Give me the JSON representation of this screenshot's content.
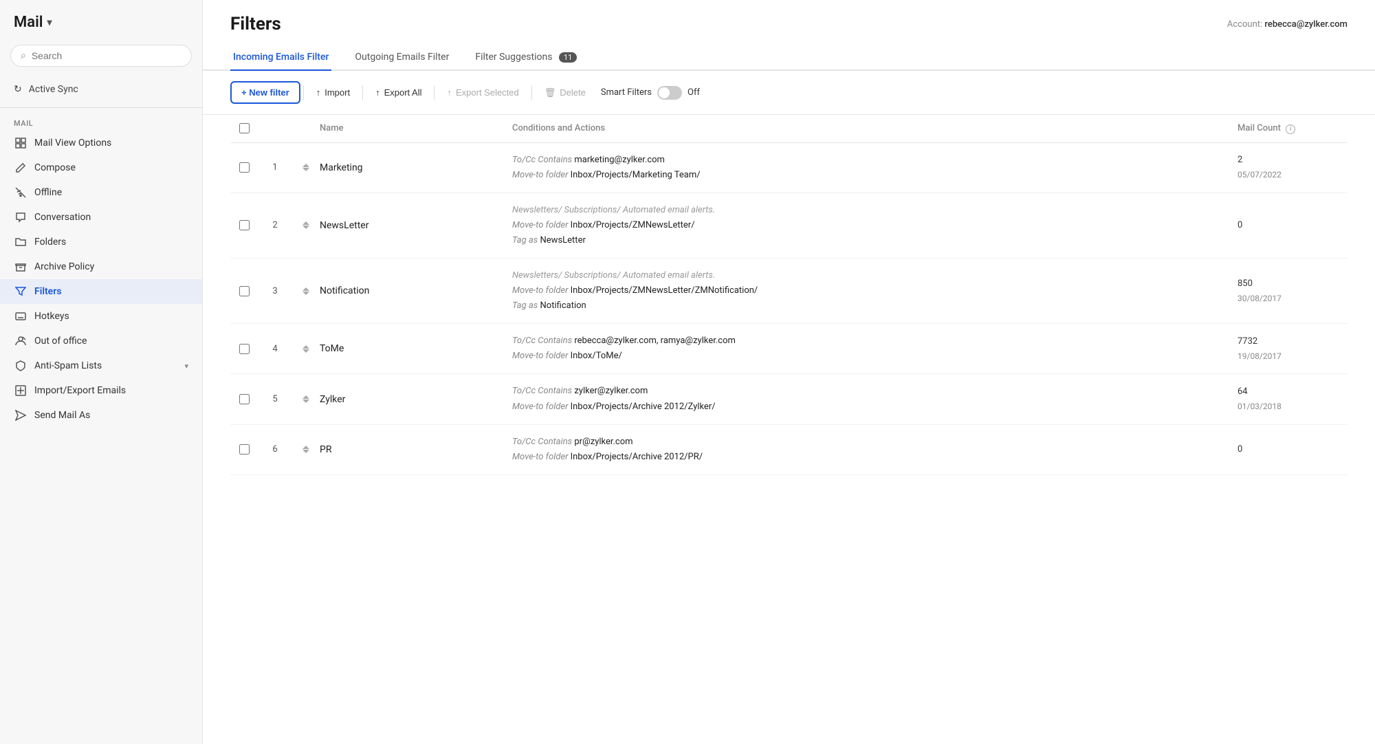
{
  "sidebar": {
    "title": "Mail",
    "search_placeholder": "Search",
    "sync_label": "Active Sync",
    "section_label": "MAIL",
    "items": [
      {
        "id": "mail-view-options",
        "label": "Mail View Options",
        "icon": "grid"
      },
      {
        "id": "compose",
        "label": "Compose",
        "icon": "edit"
      },
      {
        "id": "offline",
        "label": "Offline",
        "icon": "wifi-off"
      },
      {
        "id": "conversation",
        "label": "Conversation",
        "icon": "message"
      },
      {
        "id": "folders",
        "label": "Folders",
        "icon": "folder"
      },
      {
        "id": "archive-policy",
        "label": "Archive Policy",
        "icon": "archive"
      },
      {
        "id": "filters",
        "label": "Filters",
        "icon": "filter",
        "active": true
      },
      {
        "id": "hotkeys",
        "label": "Hotkeys",
        "icon": "hotkeys"
      },
      {
        "id": "out-of-office",
        "label": "Out of office",
        "icon": "out-of-office"
      },
      {
        "id": "anti-spam",
        "label": "Anti-Spam Lists",
        "icon": "shield",
        "has_chevron": true
      },
      {
        "id": "import-export",
        "label": "Import/Export Emails",
        "icon": "import"
      },
      {
        "id": "send-mail-as",
        "label": "Send Mail As",
        "icon": "send"
      }
    ]
  },
  "header": {
    "page_title": "Filters",
    "account_label": "Account:",
    "account_email": "rebecca@zylker.com"
  },
  "tabs": [
    {
      "id": "incoming",
      "label": "Incoming Emails Filter",
      "active": true
    },
    {
      "id": "outgoing",
      "label": "Outgoing Emails Filter",
      "active": false
    },
    {
      "id": "suggestions",
      "label": "Filter Suggestions",
      "badge": "11",
      "active": false
    }
  ],
  "toolbar": {
    "new_filter": "+ New filter",
    "import": "Import",
    "export_all": "Export All",
    "export_selected": "Export Selected",
    "delete": "Delete",
    "smart_filters": "Smart Filters",
    "toggle_state": "Off"
  },
  "table": {
    "columns": [
      {
        "id": "check",
        "label": ""
      },
      {
        "id": "num",
        "label": ""
      },
      {
        "id": "sort",
        "label": ""
      },
      {
        "id": "name",
        "label": "Name"
      },
      {
        "id": "conditions",
        "label": "Conditions and Actions"
      },
      {
        "id": "count",
        "label": "Mail Count"
      }
    ],
    "rows": [
      {
        "num": 1,
        "name": "Marketing",
        "conditions": [
          {
            "label": "To/Cc Contains",
            "value": "marketing@zylker.com"
          },
          {
            "label": "Move-to folder",
            "value": "Inbox/Projects/Marketing Team/"
          }
        ],
        "count": "2",
        "date": "05/07/2022"
      },
      {
        "num": 2,
        "name": "NewsLetter",
        "conditions": [
          {
            "label": "",
            "value": "Newsletters/ Subscriptions/ Automated email alerts."
          },
          {
            "label": "Move-to folder",
            "value": "Inbox/Projects/ZMNewsLetter/"
          },
          {
            "label": "Tag as",
            "value": "NewsLetter"
          }
        ],
        "count": "0",
        "date": ""
      },
      {
        "num": 3,
        "name": "Notification",
        "conditions": [
          {
            "label": "",
            "value": "Newsletters/ Subscriptions/ Automated email alerts."
          },
          {
            "label": "Move-to folder",
            "value": "Inbox/Projects/ZMNewsLetter/ZMNotification/"
          },
          {
            "label": "Tag as",
            "value": "Notification"
          }
        ],
        "count": "850",
        "date": "30/08/2017"
      },
      {
        "num": 4,
        "name": "ToMe",
        "conditions": [
          {
            "label": "To/Cc Contains",
            "value": "rebecca@zylker.com, ramya@zylker.com"
          },
          {
            "label": "Move-to folder",
            "value": "Inbox/ToMe/"
          }
        ],
        "count": "7732",
        "date": "19/08/2017"
      },
      {
        "num": 5,
        "name": "Zylker",
        "conditions": [
          {
            "label": "To/Cc Contains",
            "value": "zylker@zylker.com"
          },
          {
            "label": "Move-to folder",
            "value": "Inbox/Projects/Archive 2012/Zylker/"
          }
        ],
        "count": "64",
        "date": "01/03/2018"
      },
      {
        "num": 6,
        "name": "PR",
        "conditions": [
          {
            "label": "To/Cc Contains",
            "value": "pr@zylker.com"
          },
          {
            "label": "Move-to folder",
            "value": "Inbox/Projects/Archive 2012/PR/"
          }
        ],
        "count": "0",
        "date": ""
      }
    ]
  }
}
